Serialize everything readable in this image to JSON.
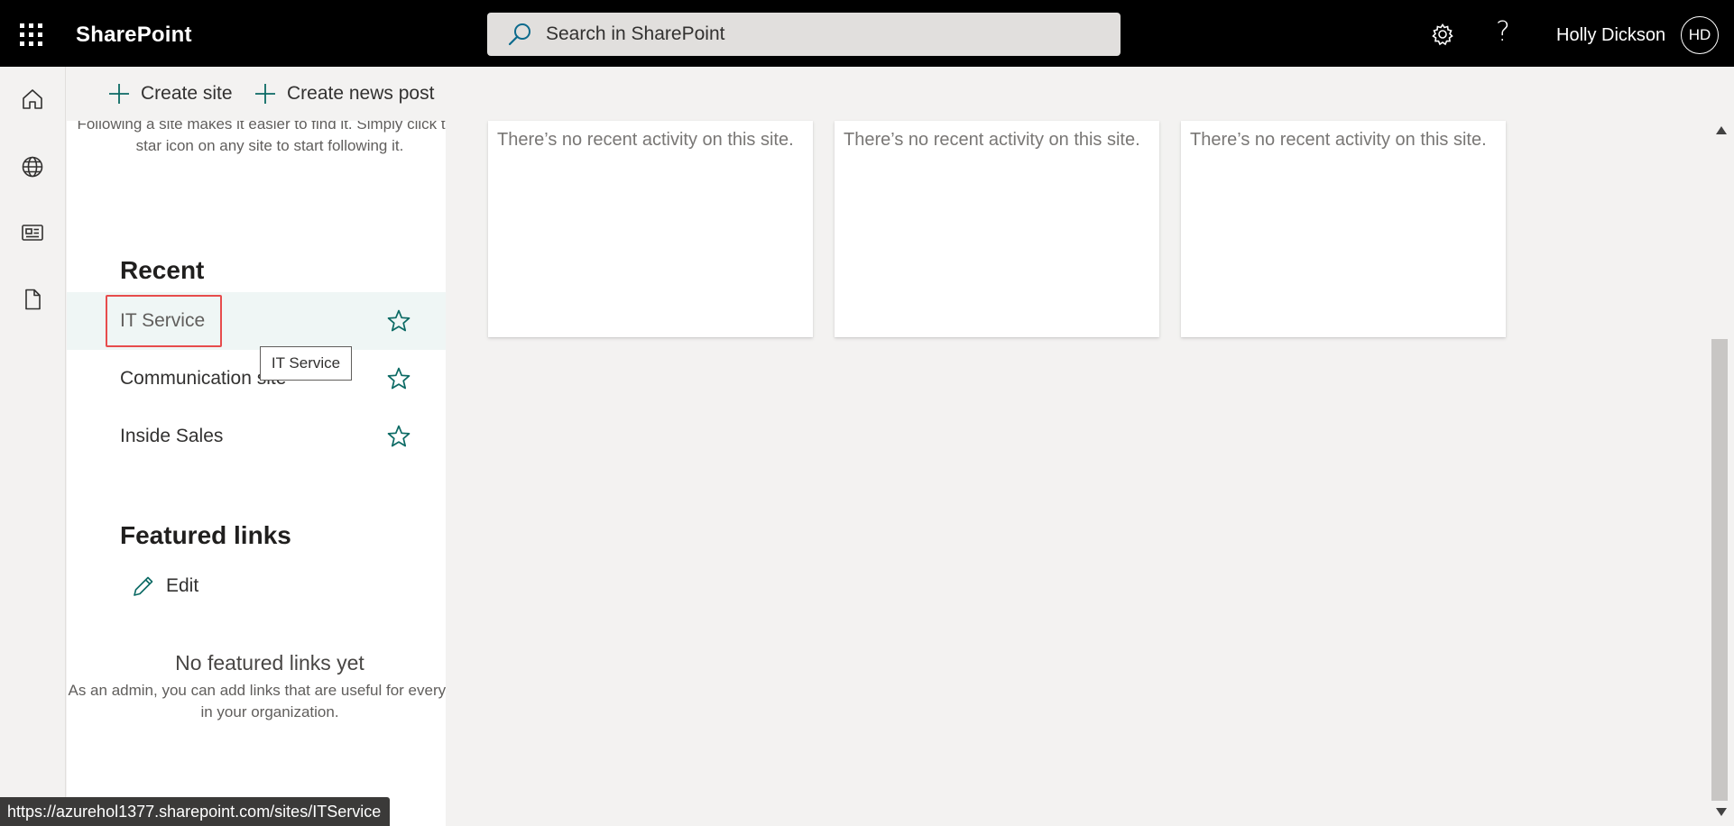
{
  "topbar": {
    "app_name": "SharePoint",
    "search_placeholder": "Search in SharePoint",
    "user_name": "Holly Dickson",
    "user_initials": "HD",
    "help_glyph": "?"
  },
  "colors": {
    "accent": "#0b6a64",
    "topbar_bg": "#000000",
    "highlight_box": "#e74c4c"
  },
  "commands": {
    "create_site": "Create site",
    "create_news_post": "Create news post"
  },
  "left_panel": {
    "following_hint": "Following a site makes it easier to find it. Simply click the star icon on any site to start following it.",
    "recent_title": "Recent",
    "recent_items": [
      {
        "label": "IT Service"
      },
      {
        "label": "Communication site"
      },
      {
        "label": "Inside Sales"
      }
    ],
    "featured_title": "Featured links",
    "edit_label": "Edit",
    "no_featured_title": "No featured links yet",
    "no_featured_desc": "As an admin, you can add links that are useful for everyone in your organization."
  },
  "cards": [
    {
      "message": "There’s no recent activity on this site."
    },
    {
      "message": "There’s no recent activity on this site."
    },
    {
      "message": "There’s no recent activity on this site."
    }
  ],
  "tooltip": "IT Service",
  "status_url": "https://azurehol1377.sharepoint.com/sites/ITService",
  "icons": {
    "rail": [
      "home-icon",
      "globe-icon",
      "news-icon",
      "document-icon"
    ]
  }
}
